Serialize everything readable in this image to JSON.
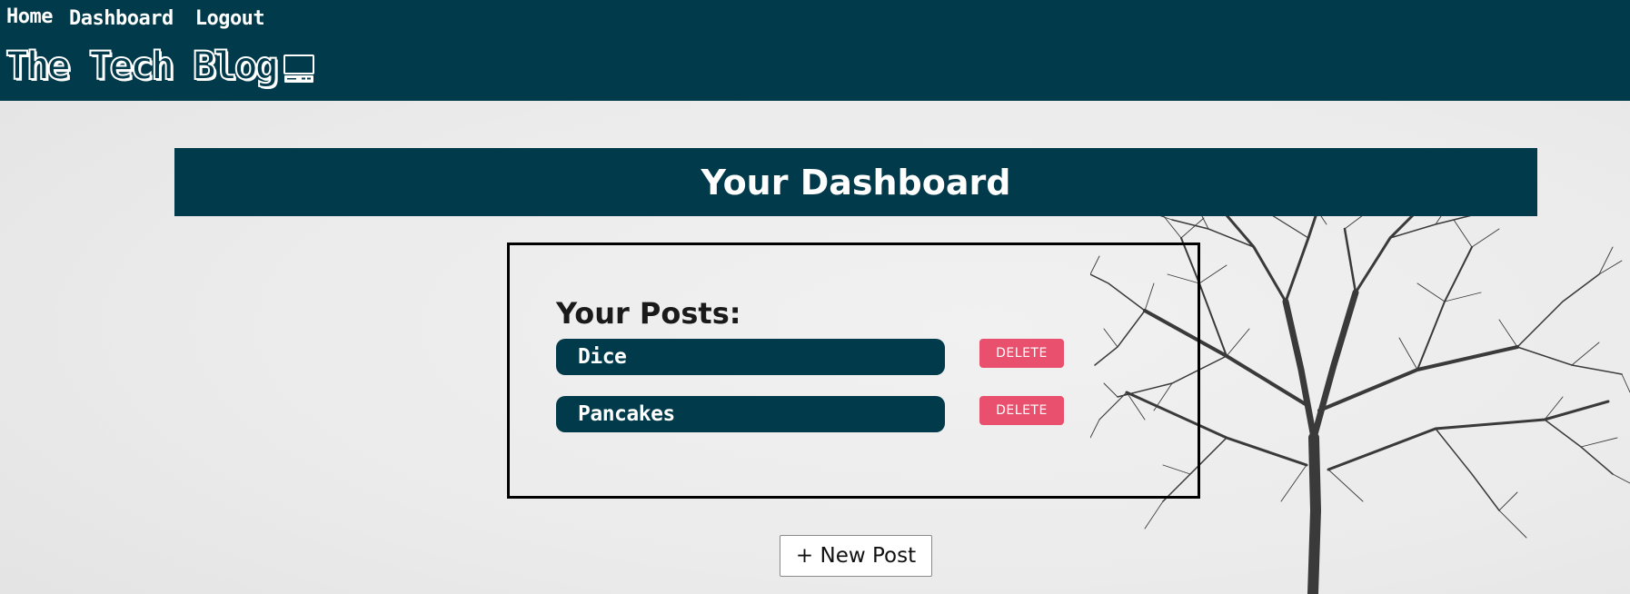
{
  "nav": {
    "home": "Home",
    "dashboard": "Dashboard",
    "logout": "Logout"
  },
  "brand": {
    "title": "The Tech Blog",
    "icon": "computer-icon"
  },
  "dashboard": {
    "title": "Your Dashboard"
  },
  "posts": {
    "heading": "Your Posts:",
    "items": [
      {
        "title": "Dice",
        "delete_label": "DELETE"
      },
      {
        "title": "Pancakes",
        "delete_label": "DELETE"
      }
    ]
  },
  "actions": {
    "new_post_label": "+ New Post"
  },
  "colors": {
    "primary": "#013a4a",
    "delete": "#e8506d",
    "background": "#ebebeb"
  }
}
